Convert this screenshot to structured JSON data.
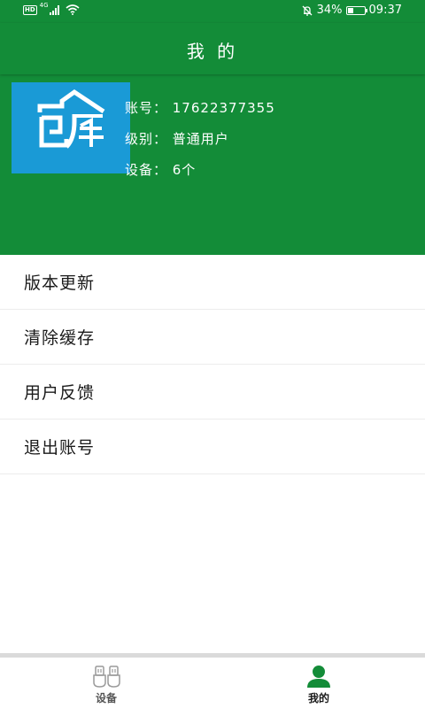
{
  "colors": {
    "primary_green": "#138c38",
    "logo_blue": "#1a9ad6",
    "active_tab_icon": "#138c38",
    "inactive_tab_icon": "#9a9a9a"
  },
  "status_bar": {
    "hd_label": "HD",
    "network_label": "4G",
    "battery_percent": "34%",
    "battery_level": 0.34,
    "time": "09:37",
    "icons": [
      "signal-icon",
      "wifi-icon",
      "mute-icon",
      "battery-icon"
    ]
  },
  "header": {
    "title": "我 的"
  },
  "profile": {
    "avatar_icon": "feiku-logo",
    "account": "账号：  17622377355",
    "level": "级别：  普通用户",
    "devices": "设备：  6个"
  },
  "menu": {
    "items": [
      {
        "label": "版本更新"
      },
      {
        "label": "清除缓存"
      },
      {
        "label": "用户反馈"
      },
      {
        "label": "退出账号"
      }
    ]
  },
  "bottom_nav": {
    "tabs": [
      {
        "label": "设备",
        "icon": "device-icon",
        "active": false
      },
      {
        "label": "我的",
        "icon": "person-icon",
        "active": true
      }
    ]
  }
}
